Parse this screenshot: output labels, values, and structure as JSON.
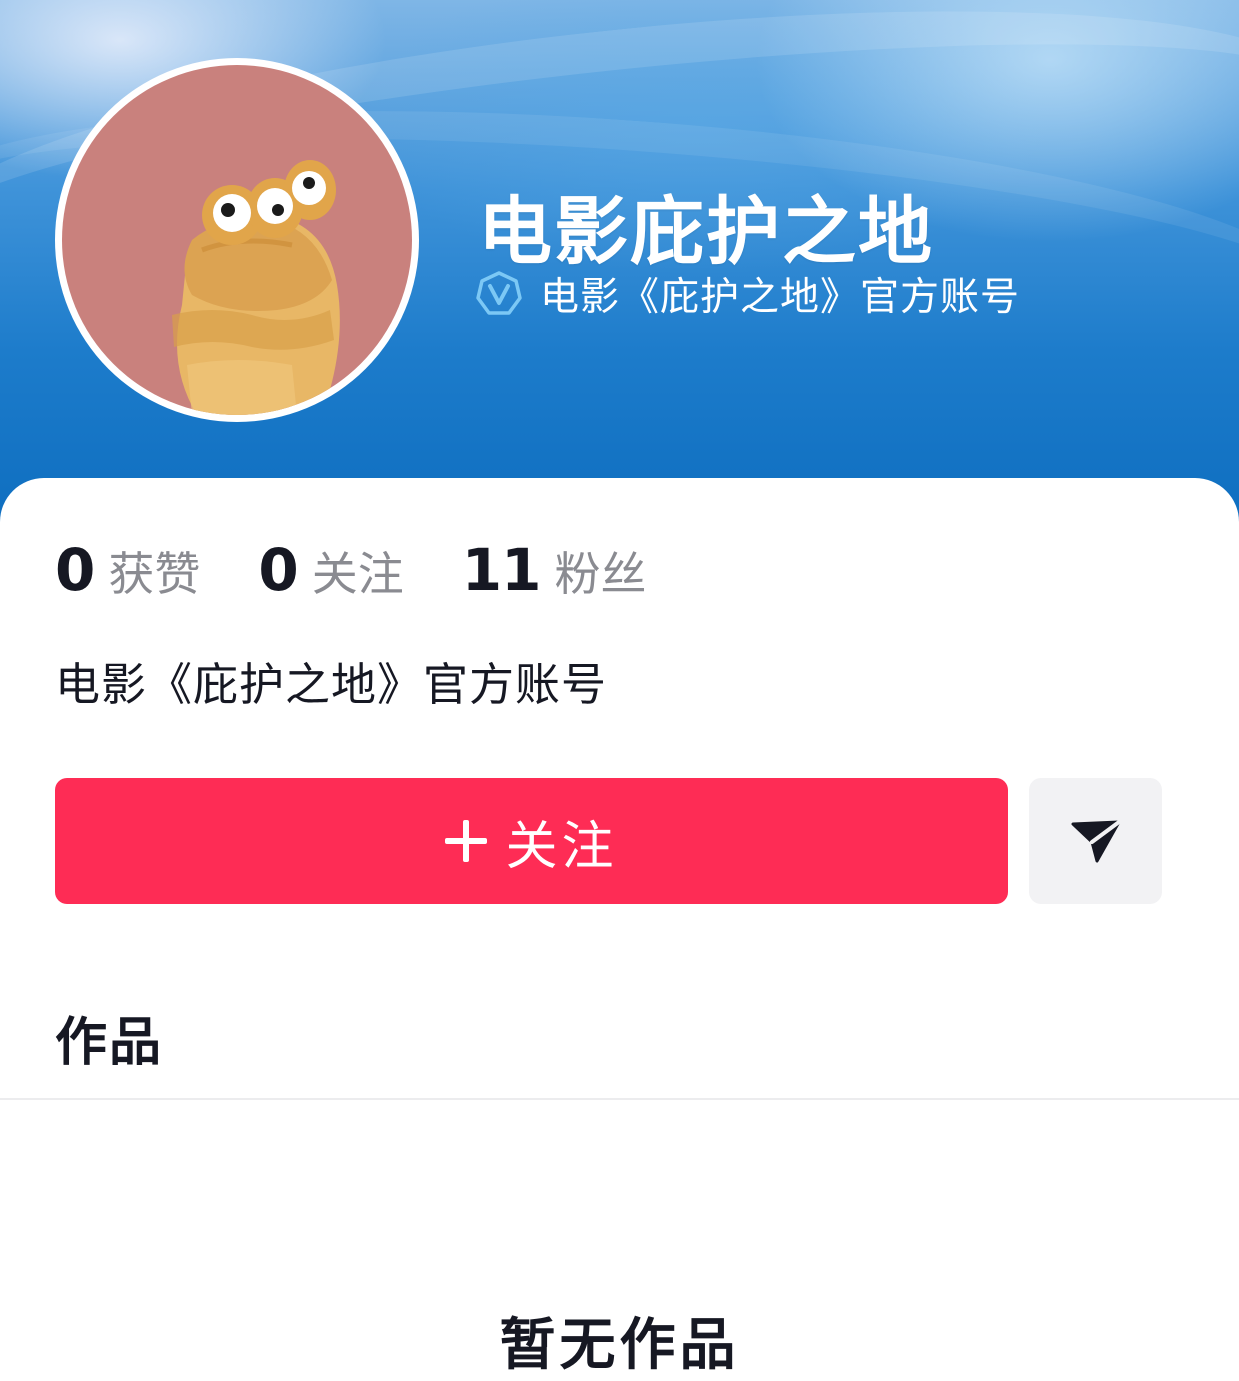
{
  "header": {
    "name": "电影庇护之地",
    "verified_text": "电影《庇护之地》官方账号",
    "icons": {
      "avatar": "avatar-cartoon-character",
      "verify": "verified-v-badge-icon"
    }
  },
  "stats": [
    {
      "value": "0",
      "label": "获赞"
    },
    {
      "value": "0",
      "label": "关注"
    },
    {
      "value": "11",
      "label": "粉丝"
    }
  ],
  "bio": "电影《庇护之地》官方账号",
  "actions": {
    "follow_label": "关注",
    "follow_icon": "plus-icon",
    "share_icon": "send-arrow-icon"
  },
  "tabs": {
    "works_label": "作品"
  },
  "empty_state": {
    "text": "暂无作品"
  },
  "colors": {
    "accent": "#fe2c55",
    "banner_blue": "#1d7ccb",
    "text_primary": "#161823",
    "text_secondary": "#8a8b91",
    "verify_blue": "#7cc8f5"
  }
}
